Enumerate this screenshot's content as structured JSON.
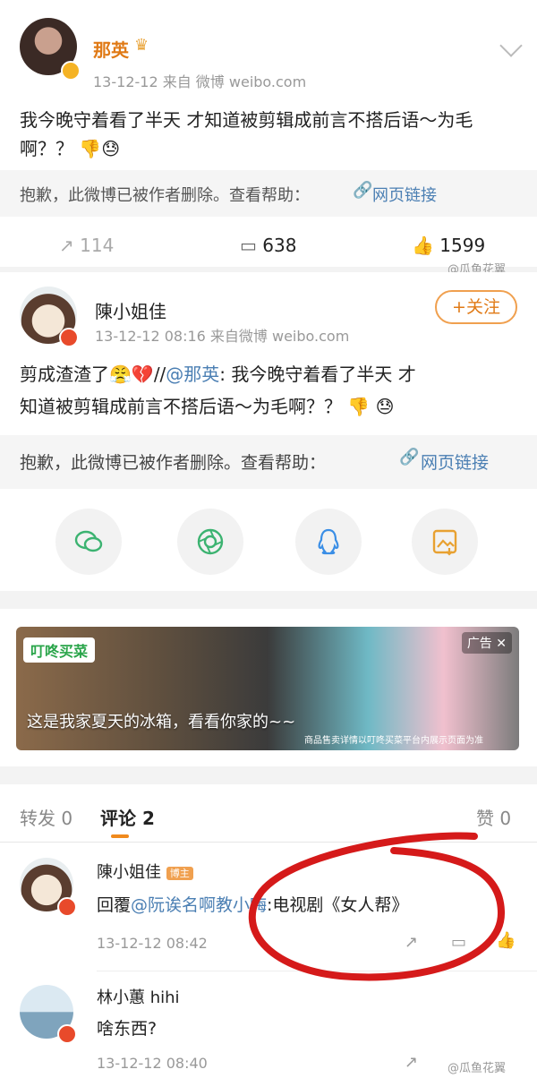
{
  "post1": {
    "author": "那英",
    "meta": "13-12-12  来自 微博 weibo.com",
    "text_line1": "我今晚守着看了半天 才知道被剪辑成前言不搭后语～为毛",
    "text_line2": "啊？？",
    "deleted_notice": "抱歉，此微博已被作者删除。查看帮助：",
    "web_link": "网页链接",
    "repost_count": "114",
    "comment_count": "638",
    "like_count": "1599"
  },
  "watermark": "@瓜鱼花翼",
  "post2": {
    "author": "陳小姐佳",
    "meta": "13-12-12 08:16  来自微博 weibo.com",
    "follow_label": "+关注",
    "text_prefix": "剪成渣渣了",
    "text_sep": "//",
    "mention": "@那英",
    "text_rest1": ": 我今晚守着看了半天 才",
    "text_line2": "知道被剪辑成前言不搭后语～为毛啊？？",
    "deleted_notice": "抱歉，此微博已被作者删除。查看帮助：",
    "web_link": "网页链接"
  },
  "share_icons": [
    "wechat-icon",
    "moments-icon",
    "qq-icon",
    "save-image-icon"
  ],
  "ad": {
    "brand": "叮咚买菜",
    "badge": "广告",
    "close": "✕",
    "caption": "这是我家夏天的冰箱，看看你家的~~",
    "fine_print": "商品售卖详情以叮咚买菜平台内展示页面为准"
  },
  "tabs": {
    "repost": "转发 0",
    "comments": "评论 2",
    "likes": "赞 0"
  },
  "comments": [
    {
      "author": "陳小姐佳",
      "badge": "博主",
      "reply_prefix": "回覆",
      "mention": "@阮诶名啊教小嗨",
      "text": ":电视剧《女人帮》",
      "time": "13-12-12 08:42"
    },
    {
      "author": "林小蕙 hihi",
      "text": "啥东西?",
      "time": "13-12-12 08:40"
    }
  ],
  "colors": {
    "accent": "#f08a1d",
    "link": "#4b7fb3",
    "annotation_circle": "#d51a1a"
  }
}
